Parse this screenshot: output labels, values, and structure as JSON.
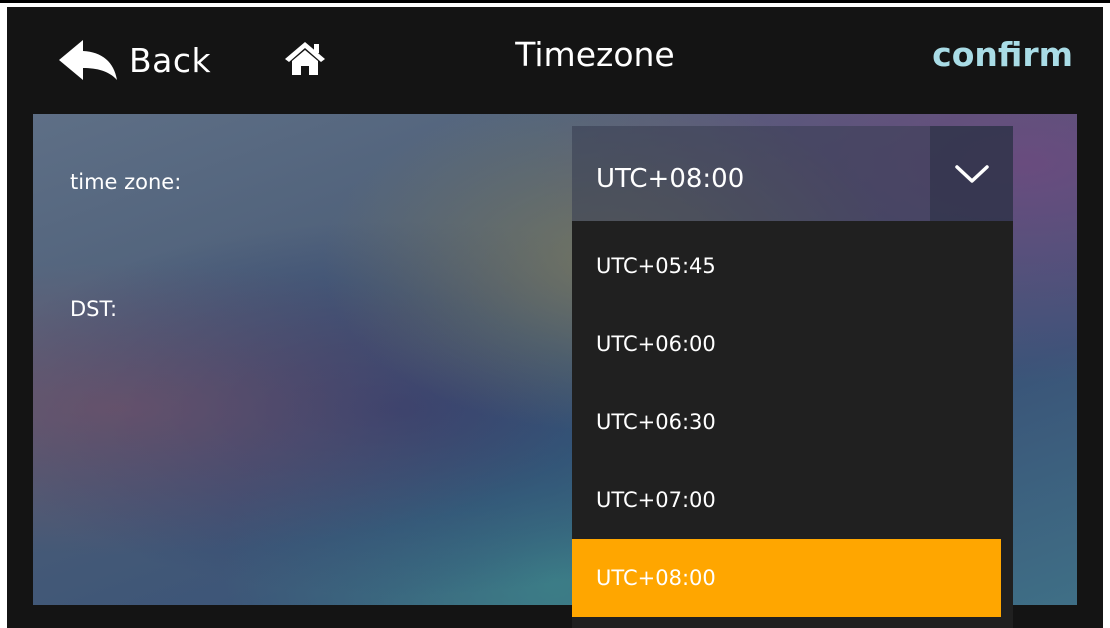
{
  "header": {
    "back_label": "Back",
    "title": "Timezone",
    "confirm_label": "confirm"
  },
  "icons": {
    "back": "back-arrow-icon",
    "home": "home-icon",
    "dropdown": "chevron-down-icon"
  },
  "form": {
    "time_zone_label": "time zone:",
    "dst_label": "DST:",
    "selected_timezone": "UTC+08:00"
  },
  "dropdown": {
    "options": [
      "UTC+05:45",
      "UTC+06:00",
      "UTC+06:30",
      "UTC+07:00",
      "UTC+08:00"
    ],
    "selected_index": 4
  },
  "colors": {
    "confirm": "#a9dce6",
    "selected_option": "#ffa600",
    "header_bg": "#141414",
    "dropdown_bg": "#202020"
  }
}
